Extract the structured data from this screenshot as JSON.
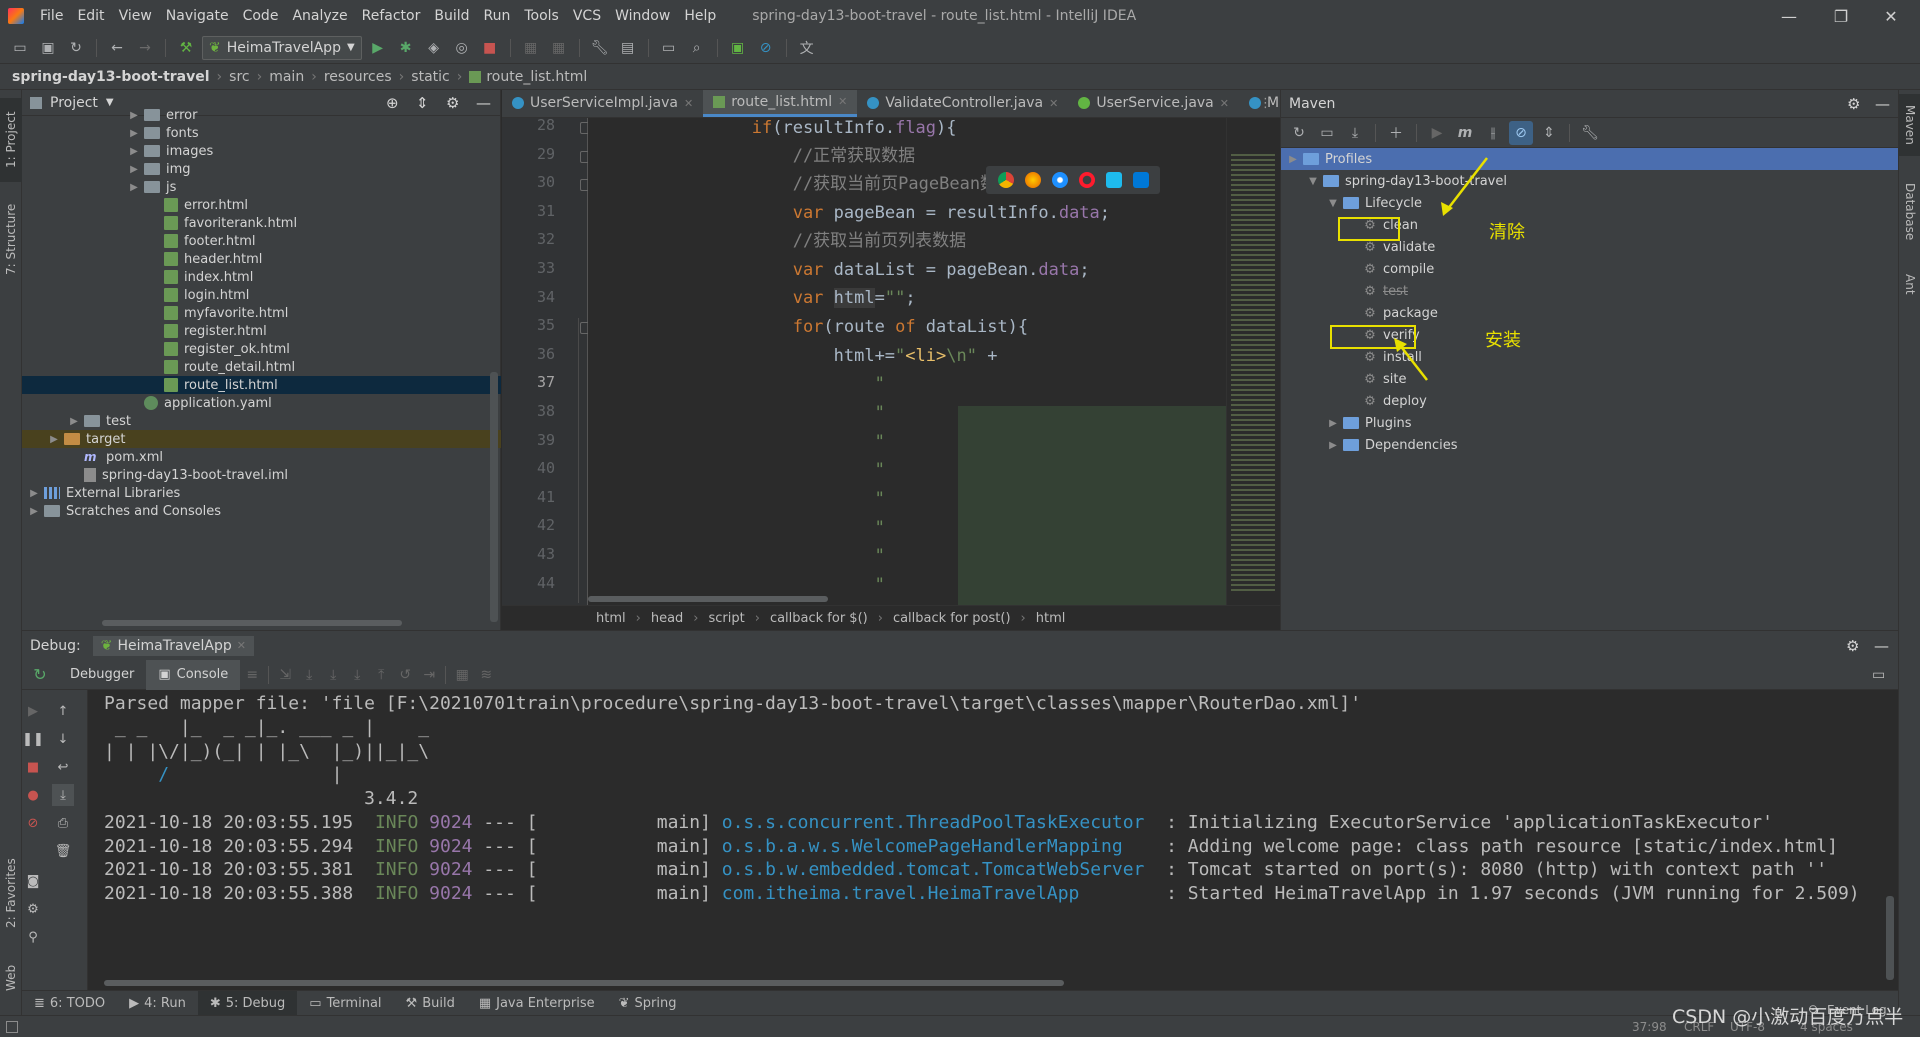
{
  "menubar": {
    "items": [
      "File",
      "Edit",
      "View",
      "Navigate",
      "Code",
      "Analyze",
      "Refactor",
      "Build",
      "Run",
      "Tools",
      "VCS",
      "Window",
      "Help"
    ],
    "title": "spring-day13-boot-travel - route_list.html - IntelliJ IDEA"
  },
  "toolbar": {
    "run_config": "HeimaTravelApp"
  },
  "navbar": {
    "crumbs": [
      "spring-day13-boot-travel",
      "src",
      "main",
      "resources",
      "static",
      "route_list.html"
    ]
  },
  "left_strip": {
    "project_label": "1: Project",
    "structure_label": "7: Structure",
    "favorites_label": "2: Favorites",
    "web_label": "Web"
  },
  "right_strip": {
    "maven_label": "Maven",
    "database_label": "Database",
    "ant_label": "Ant"
  },
  "project": {
    "title": "Project",
    "rows": [
      {
        "label": "error",
        "kind": "folder",
        "indent": 5
      },
      {
        "label": "fonts",
        "kind": "folder",
        "indent": 5
      },
      {
        "label": "images",
        "kind": "folder",
        "indent": 5
      },
      {
        "label": "img",
        "kind": "folder",
        "indent": 5
      },
      {
        "label": "js",
        "kind": "folder",
        "indent": 5
      },
      {
        "label": "error.html",
        "kind": "html",
        "indent": 6
      },
      {
        "label": "favoriterank.html",
        "kind": "html",
        "indent": 6
      },
      {
        "label": "footer.html",
        "kind": "html",
        "indent": 6
      },
      {
        "label": "header.html",
        "kind": "html",
        "indent": 6
      },
      {
        "label": "index.html",
        "kind": "html",
        "indent": 6
      },
      {
        "label": "login.html",
        "kind": "html",
        "indent": 6
      },
      {
        "label": "myfavorite.html",
        "kind": "html",
        "indent": 6
      },
      {
        "label": "register.html",
        "kind": "html",
        "indent": 6
      },
      {
        "label": "register_ok.html",
        "kind": "html",
        "indent": 6
      },
      {
        "label": "route_detail.html",
        "kind": "html",
        "indent": 6
      },
      {
        "label": "route_list.html",
        "kind": "html",
        "indent": 6,
        "selected": true
      },
      {
        "label": "application.yaml",
        "kind": "yaml",
        "indent": 5
      },
      {
        "label": "test",
        "kind": "folder",
        "indent": 2
      },
      {
        "label": "target",
        "kind": "folder-orange",
        "indent": 1
      },
      {
        "label": "pom.xml",
        "kind": "maven",
        "indent": 2
      },
      {
        "label": "spring-day13-boot-travel.iml",
        "kind": "iml",
        "indent": 2
      },
      {
        "label": "External Libraries",
        "kind": "lib",
        "indent": 0
      },
      {
        "label": "Scratches and Consoles",
        "kind": "scratch",
        "indent": 0
      }
    ]
  },
  "editor": {
    "tabs": [
      {
        "label": "UserServiceImpl.java",
        "icon": "class",
        "active": false
      },
      {
        "label": "route_list.html",
        "icon": "html",
        "active": true
      },
      {
        "label": "ValidateController.java",
        "icon": "class",
        "active": false
      },
      {
        "label": "UserService.java",
        "icon": "interface",
        "active": false
      },
      {
        "label": "MailS",
        "icon": "class",
        "active": false
      }
    ],
    "line_numbers": [
      "28",
      "29",
      "30",
      "31",
      "32",
      "33",
      "34",
      "35",
      "36",
      "37",
      "38",
      "39",
      "40",
      "41",
      "42",
      "43",
      "44"
    ],
    "current_line": "37",
    "breadcrumb": [
      "html",
      "head",
      "script",
      "callback for $()",
      "callback for post()",
      "html"
    ]
  },
  "maven": {
    "title": "Maven",
    "profiles": "Profiles",
    "project": "spring-day13-boot-travel",
    "lifecycle": "Lifecycle",
    "goals": [
      "clean",
      "validate",
      "compile",
      "test",
      "package",
      "verify",
      "install",
      "site",
      "deploy"
    ],
    "plugins": "Plugins",
    "dependencies": "Dependencies",
    "annotation_clean": "清除",
    "annotation_install": "安装"
  },
  "debug": {
    "title": "Debug:",
    "config": "HeimaTravelApp",
    "tab_debugger": "Debugger",
    "tab_console": "Console"
  },
  "bottom_tabs": [
    {
      "label": "6: TODO",
      "icon": "≣"
    },
    {
      "label": "4: Run",
      "icon": "▶"
    },
    {
      "label": "5: Debug",
      "icon": "✱",
      "active": true
    },
    {
      "label": "Terminal",
      "icon": "▭"
    },
    {
      "label": "Build",
      "icon": "⚒"
    },
    {
      "label": "Java Enterprise",
      "icon": "▦"
    },
    {
      "label": "Spring",
      "icon": "❦"
    }
  ],
  "status": {
    "event_log": "Event Log",
    "position": "37:98",
    "line_sep": "CRLF",
    "encoding": "UTF-8",
    "indent": "4 spaces",
    "watermark": "CSDN @小激动百度万点半"
  },
  "colors": {
    "accent": "#4a88c7",
    "highlight_box": "#e8e000",
    "selection": "#4b6eaf"
  }
}
